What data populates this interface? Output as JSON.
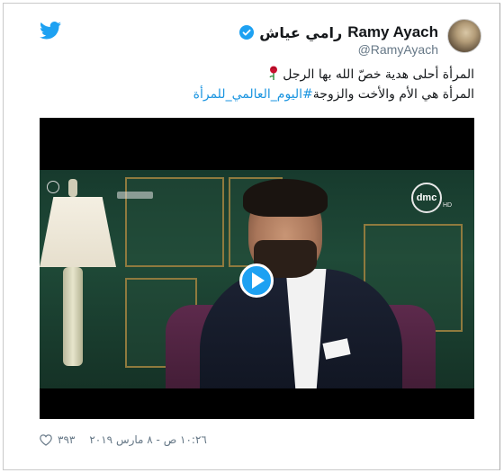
{
  "tweet": {
    "author": {
      "name_latin": "Ramy Ayach",
      "name_arabic": "رامي عياش",
      "handle": "@RamyAyach",
      "verified": true,
      "avatar_icon": "avatar-photo"
    },
    "text": {
      "line1": "المرأة أحلى هدية خصّ الله بها الرجل",
      "line2_prefix": "المرأة هي الأم والأخت والزوجة",
      "hashtag": "#اليوم_العالمي_للمرأة"
    },
    "media": {
      "type": "video",
      "channel_logo": "dmc",
      "channel_hd": "HD",
      "play_icon": "play-icon"
    },
    "footer": {
      "likes": "٣٩٣",
      "timestamp": "١٠:٢٦ ص - ٨ مارس ٢٠١٩"
    },
    "colors": {
      "twitter_blue": "#1da1f2",
      "hashtag": "#1b95e0",
      "text": "#14171a",
      "muted": "#657786"
    }
  },
  "icons": [
    "twitter-bird-icon",
    "verified-badge-icon",
    "rose-emoji-icon",
    "play-icon",
    "heart-icon"
  ]
}
